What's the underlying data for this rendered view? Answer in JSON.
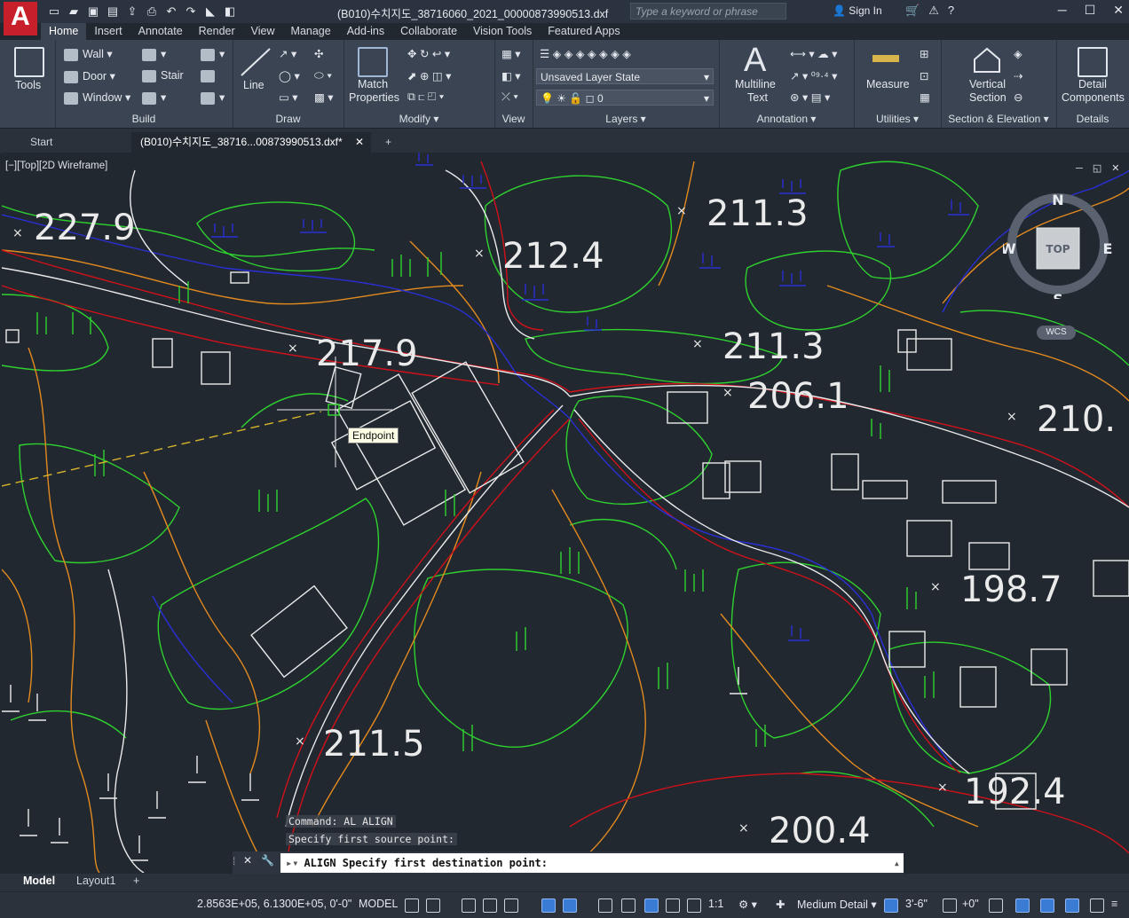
{
  "app": {
    "logo_letter": "A",
    "logo_sub": "A",
    "accent": "#c8202a"
  },
  "titlebar": {
    "title": "(B010)수치지도_38716060_2021_00000873990513.dxf",
    "search_placeholder": "Type a keyword or phrase",
    "sign_in": "Sign In",
    "qat_icons": [
      "new-icon",
      "open-icon",
      "save-icon",
      "saveas-icon",
      "upload-icon",
      "print-icon",
      "undo-icon",
      "redo-icon"
    ]
  },
  "ribbon_tabs": [
    "Home",
    "Insert",
    "Annotate",
    "Render",
    "View",
    "Manage",
    "Add-ins",
    "Collaborate",
    "Vision Tools",
    "Featured Apps"
  ],
  "ribbon": {
    "tools": {
      "label": "Tools",
      "panel": ""
    },
    "build": {
      "wall": "Wall",
      "door": "Door",
      "window": "Window",
      "stair": "Stair",
      "panel": "Build"
    },
    "draw": {
      "line": "Line",
      "panel": "Draw"
    },
    "modify": {
      "match1": "Match",
      "match2": "Properties",
      "panel": "Modify"
    },
    "view": {
      "panel": "View"
    },
    "layers": {
      "layer_state": "Unsaved Layer State",
      "current_layer": "0",
      "panel": "Layers"
    },
    "annotation": {
      "mtext1": "Multiline",
      "mtext2": "Text",
      "panel": "Annotation"
    },
    "utilities": {
      "measure": "Measure",
      "panel": "Utilities"
    },
    "section": {
      "vs1": "Vertical",
      "vs2": "Section",
      "panel": "Section & Elevation"
    },
    "details": {
      "dc1": "Detail",
      "dc2": "Components",
      "panel": "Details"
    }
  },
  "doc_tabs": {
    "start": "Start",
    "active": "(B010)수치지도_38716...00873990513.dxf*"
  },
  "viewport": {
    "label": "[−][Top][2D Wireframe]",
    "tooltip": "Endpoint",
    "elevations": [
      "227.9",
      "212.4",
      "211.3",
      "217.9",
      "211.3",
      "206.1",
      "210.",
      "198.7",
      "211.5",
      "192.4",
      "200.4"
    ],
    "compass": {
      "n": "N",
      "s": "S",
      "e": "E",
      "w": "W",
      "top": "TOP",
      "wcs": "WCS"
    }
  },
  "command": {
    "history": [
      "Command: AL ALIGN",
      "Specify first source point:"
    ],
    "prompt": "ALIGN Specify first destination point:"
  },
  "layout_tabs": [
    "Model",
    "Layout1"
  ],
  "status": {
    "coords": "2.8563E+05, 6.1300E+05, 0'-0\"",
    "space": "MODEL",
    "scale": "1:1",
    "detail": "Medium Detail",
    "elevation": "3'-6\"",
    "offset": "+0\""
  }
}
